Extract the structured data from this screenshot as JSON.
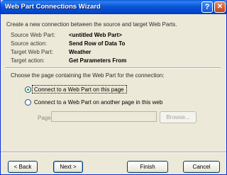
{
  "window": {
    "title": "Web Part Connections Wizard",
    "help_glyph": "?",
    "close_glyph": "✕"
  },
  "intro_text": "Create a new connection between the source and target Web Parts.",
  "details": [
    {
      "label": "Source Web Part:",
      "value": "<untitled Web Part>"
    },
    {
      "label": "Source action:",
      "value": "Send Row of Data To"
    },
    {
      "label": "Target Web Part:",
      "value": "Weather"
    },
    {
      "label": "Target action:",
      "value": "Get Parameters From"
    }
  ],
  "choose_text": "Choose the page containing the Web Part for the connection:",
  "options": [
    {
      "label": "Connect to a Web Part on this page",
      "selected": true
    },
    {
      "label": "Connect to a Web Part on another page in this web",
      "selected": false
    }
  ],
  "page_field": {
    "label": "Page:",
    "value": ""
  },
  "buttons": {
    "browse": "Browse...",
    "back": "< Back",
    "next": "Next >",
    "finish": "Finish",
    "cancel": "Cancel"
  }
}
